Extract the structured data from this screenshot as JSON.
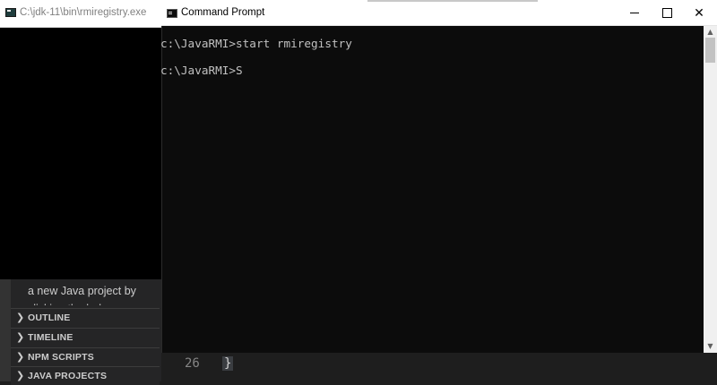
{
  "rmi_window": {
    "title": "C:\\jdk-11\\bin\\rmiregistry.exe",
    "icon": "console-icon"
  },
  "sidebar": {
    "welcome_text": "a new Java project by clicking the below",
    "sections": [
      {
        "label": "OUTLINE",
        "icon": "chevron-right-icon"
      },
      {
        "label": "TIMELINE",
        "icon": "chevron-right-icon"
      },
      {
        "label": "NPM SCRIPTS",
        "icon": "chevron-right-icon"
      },
      {
        "label": "JAVA PROJECTS",
        "icon": "chevron-right-icon"
      }
    ]
  },
  "editor": {
    "line_number": "26",
    "code": "}"
  },
  "cmd_window": {
    "title": "Command Prompt",
    "icon": "cmd-icon",
    "controls": {
      "minimize": "minimize-icon",
      "maximize": "maximize-icon",
      "close": "✕"
    },
    "lines": [
      "c:\\JavaRMI>start rmiregistry",
      "c:\\JavaRMI>S"
    ]
  },
  "colors": {
    "console_bg": "#0c0c0c",
    "console_text": "#c0c0c0",
    "vscode_sidebar": "#252526",
    "vscode_editor": "#1e1e1e"
  }
}
